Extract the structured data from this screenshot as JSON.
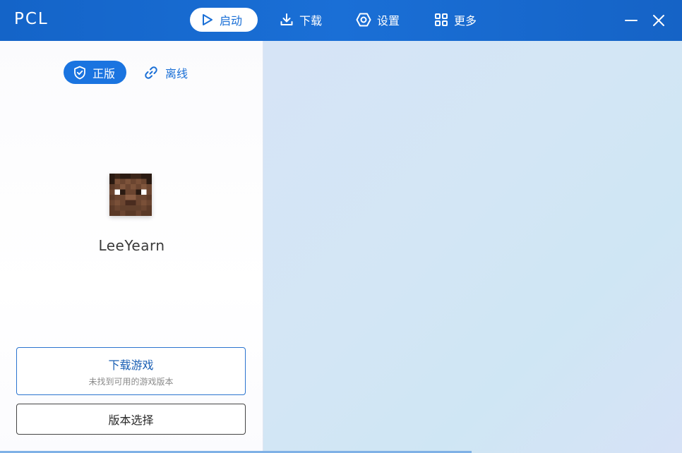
{
  "app": {
    "logo": "PCL"
  },
  "nav": {
    "launch": "启动",
    "download": "下载",
    "settings": "设置",
    "more": "更多"
  },
  "login_mode": {
    "official": "正版",
    "offline": "离线"
  },
  "user": {
    "name": "LeeYearn"
  },
  "actions": {
    "download_game": "下载游戏",
    "download_game_sub": "未找到可用的游戏版本",
    "version_select": "版本选择"
  },
  "colors": {
    "titlebar": "#1a6fd6",
    "accent": "#1a74e0",
    "right_panel": "#d3e6f5"
  }
}
